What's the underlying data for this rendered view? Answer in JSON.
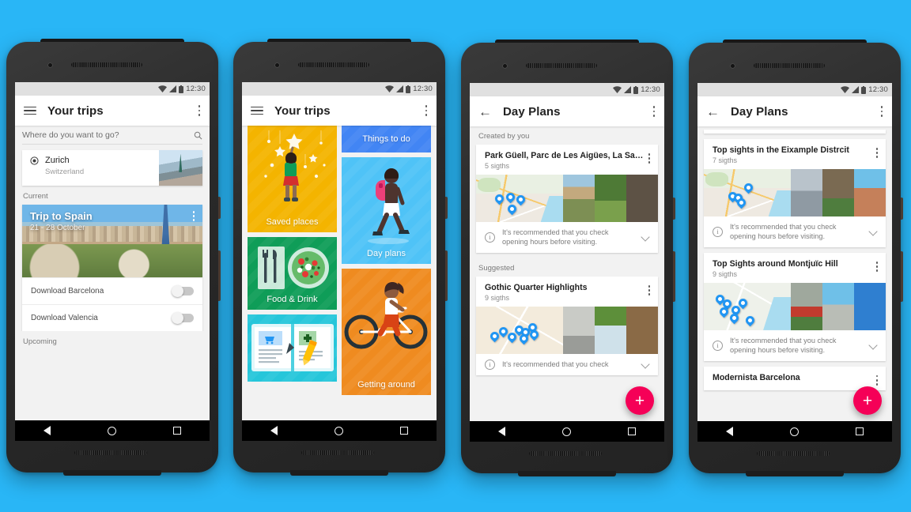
{
  "background_color": "#29B6F6",
  "status_bar": {
    "time": "12:30",
    "icons": [
      "wifi-icon",
      "signal-icon",
      "battery-icon"
    ]
  },
  "nav_bar": {
    "back": "back-triangle",
    "home": "home-circle",
    "recents": "recents-square"
  },
  "phones": [
    {
      "id": "phone-1",
      "app_bar": {
        "menu_icon": "hamburger-icon",
        "title": "Your trips",
        "overflow_icon": "kebab-icon"
      },
      "search": {
        "placeholder": "Where do you want to go?",
        "icon": "search-icon"
      },
      "suggestion": {
        "icon": "location-target-icon",
        "name": "Zurich",
        "country": "Switzerland"
      },
      "sections": {
        "current": "Current",
        "upcoming": "Upcoming"
      },
      "trip": {
        "title": "Trip to Spain",
        "dates": "21 - 28 October",
        "overflow_icon": "kebab-icon"
      },
      "downloads": [
        {
          "label": "Download Barcelona",
          "state": "off"
        },
        {
          "label": "Download Valencia",
          "state": "off"
        }
      ]
    },
    {
      "id": "phone-2",
      "app_bar": {
        "menu_icon": "hamburger-icon",
        "title": "Your trips",
        "overflow_icon": "kebab-icon"
      },
      "tiles": [
        {
          "label": "Saved places",
          "color": "#F4B400",
          "art": "person-reaching-stars"
        },
        {
          "label": "Things to do",
          "color": "#4285F4",
          "art": "none"
        },
        {
          "label": "Day plans",
          "color": "#4FC3F7",
          "art": "walking-person-backpack"
        },
        {
          "label": "Food & Drink",
          "color": "#0F9D58",
          "art": "salad-fork-knife"
        },
        {
          "label": "Getting around",
          "color": "#EF8B20",
          "art": "person-cycling"
        },
        {
          "label": "",
          "color": "#26C6DA",
          "art": "open-notebook-pen"
        }
      ]
    },
    {
      "id": "phone-3",
      "app_bar": {
        "back_icon": "back-arrow-icon",
        "title": "Day Plans",
        "overflow_icon": "kebab-icon"
      },
      "sections": [
        {
          "label": "Created by you",
          "cards": [
            {
              "title": "Park Güell, Parc de Les Aigües, La Sa…",
              "sights": "5 sigths",
              "info": "It's recommended that you check opening hours before visiting.",
              "info_icon": "info-icon",
              "expand_icon": "chevron-down-icon",
              "overflow_icon": "kebab-icon",
              "pin_count": 4
            }
          ]
        },
        {
          "label": "Suggested",
          "cards": [
            {
              "title": "Gothic Quarter Highlights",
              "sights": "9 sigths",
              "info": "It's recommended that you check",
              "info_icon": "info-icon",
              "expand_icon": "chevron-down-icon",
              "overflow_icon": "kebab-icon",
              "pin_count": 8
            }
          ]
        }
      ],
      "fab": {
        "label": "+",
        "color": "#F50057",
        "name": "add-day-plan-fab"
      }
    },
    {
      "id": "phone-4",
      "app_bar": {
        "back_icon": "back-arrow-icon",
        "title": "Day Plans",
        "overflow_icon": "kebab-icon"
      },
      "cards": [
        {
          "title": "Top sights in the Eixample Distrcit",
          "sights": "7 sigths",
          "info": "It's recommended that you check opening hours before visiting.",
          "info_icon": "info-icon",
          "expand_icon": "chevron-down-icon",
          "overflow_icon": "kebab-icon",
          "pin_count": 4
        },
        {
          "title": "Top Sights around Montjuïc Hill",
          "sights": "9 sigths",
          "info": "It's recommended that you check opening hours before visiting.",
          "info_icon": "info-icon",
          "expand_icon": "chevron-down-icon",
          "overflow_icon": "kebab-icon",
          "pin_count": 7
        },
        {
          "title": "Modernista Barcelona",
          "sights": "",
          "info": "",
          "info_icon": "",
          "expand_icon": "",
          "overflow_icon": "kebab-icon",
          "pin_count": 0
        }
      ],
      "fab": {
        "label": "+",
        "color": "#F50057",
        "name": "add-day-plan-fab"
      }
    }
  ]
}
